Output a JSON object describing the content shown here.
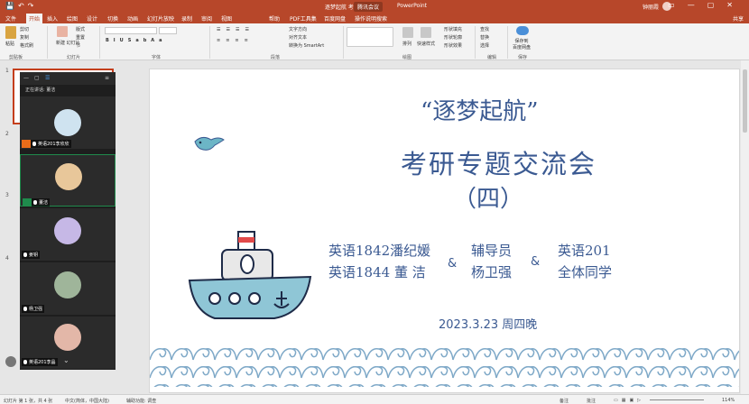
{
  "app": {
    "title": "逐梦起航 考...",
    "meeting_badge": "腾讯会议",
    "app_name": "PowerPoint",
    "user": "钟丽霞"
  },
  "tabs": [
    "文件",
    "开始",
    "插入",
    "绘图",
    "设计",
    "切换",
    "动画",
    "幻灯片放映",
    "录制",
    "审阅",
    "视图",
    "帮助",
    "PDF工具集",
    "百度网盘"
  ],
  "tell_me": "操作说明搜索",
  "share": "共享",
  "ribbon": {
    "paste": "粘贴",
    "cut": "剪切",
    "copy": "复制",
    "format_painter": "格式刷",
    "new_slide": "新建\n幻灯片",
    "layout": "版式",
    "reset": "重置",
    "section": "节",
    "text_direction": "文字方向",
    "align_text": "对齐文本",
    "smartart": "转换为 SmartArt",
    "arrange": "排列",
    "quick_styles": "快速样式",
    "shape_fill": "形状填充",
    "shape_outline": "形状轮廓",
    "shape_effects": "形状效果",
    "find": "查找",
    "replace": "替换",
    "select": "选择",
    "save_baidu": "保存到\n百度网盘",
    "groups": [
      "剪贴板",
      "幻灯片",
      "字体",
      "段落",
      "绘图",
      "编辑",
      "保存"
    ]
  },
  "slide_numbers": [
    "1",
    "2",
    "3",
    "4"
  ],
  "overlay": {
    "speaking": "正在讲话: 董洁",
    "participants": [
      {
        "name": "英语201李欣欣"
      },
      {
        "name": "董洁"
      },
      {
        "name": "姜钥"
      },
      {
        "name": "杨卫强"
      },
      {
        "name": "英语201李晶"
      }
    ]
  },
  "slide": {
    "title1": "“逐梦起航”",
    "title2": "考研专题交流会",
    "title3": "（四）",
    "left_line1": "英语1842潘纪媛",
    "left_line2": "英语1844 董 洁",
    "amp": "&",
    "mid_line1": "辅导员",
    "mid_line2": "杨卫强",
    "right_line1": "英语201",
    "right_line2": "全体同学",
    "date": "2023.3.23 周四晚"
  },
  "status": {
    "slide_of": "幻灯片 第 1 张，共 4 张",
    "language": "中文(简体，中国大陆)",
    "accessibility": "辅助功能: 调查",
    "notes": "备注",
    "comments": "批注",
    "zoom": "114%"
  },
  "colors": {
    "accent": "#b7472a",
    "navy": "#3b5a92",
    "boat": "#8fc6d6"
  }
}
